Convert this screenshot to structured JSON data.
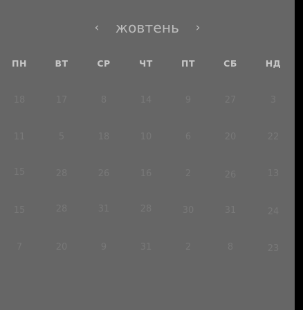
{
  "calendar": {
    "month": "жовтень",
    "prev_icon": "‹",
    "next_icon": "›",
    "weekdays": [
      "ПН",
      "ВТ",
      "СР",
      "ЧТ",
      "ПТ",
      "СБ",
      "НД"
    ],
    "weeks": [
      [
        "18",
        "17",
        "8",
        "14",
        "9",
        "27",
        "3"
      ],
      [
        "11",
        "5",
        "18",
        "10",
        "6",
        "20",
        "22"
      ],
      [
        "15",
        "28",
        "26",
        "16",
        "2",
        "26",
        "13"
      ],
      [
        "15",
        "28",
        "31",
        "28",
        "30",
        "31",
        "24"
      ],
      [
        "7",
        "20",
        "9",
        "31",
        "2",
        "8",
        "23"
      ]
    ]
  },
  "colors": {
    "panel_background": "#666666",
    "page_background": "#000000",
    "header_text": "#bcbcbc",
    "weekday_text": "#c6c6c6",
    "day_text": "#787878"
  }
}
